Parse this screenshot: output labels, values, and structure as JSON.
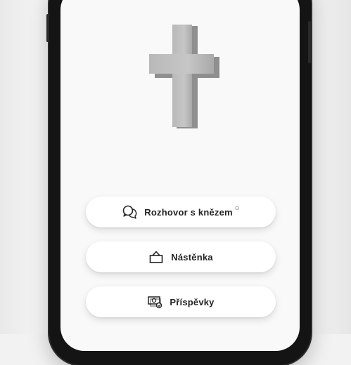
{
  "menu": {
    "items": [
      {
        "label": "Rozhovor s knězem",
        "icon": "chat-bubbles-icon",
        "badge": "⊙"
      },
      {
        "label": "Nástěnka",
        "icon": "bag-icon"
      },
      {
        "label": "Příspěvky",
        "icon": "donation-icon"
      }
    ]
  },
  "colors": {
    "screen_bg": "#f9f9f9",
    "phone_frame": "#141414",
    "cross": "#bdbdbd",
    "button_bg": "#ffffff",
    "button_text": "#222222"
  }
}
